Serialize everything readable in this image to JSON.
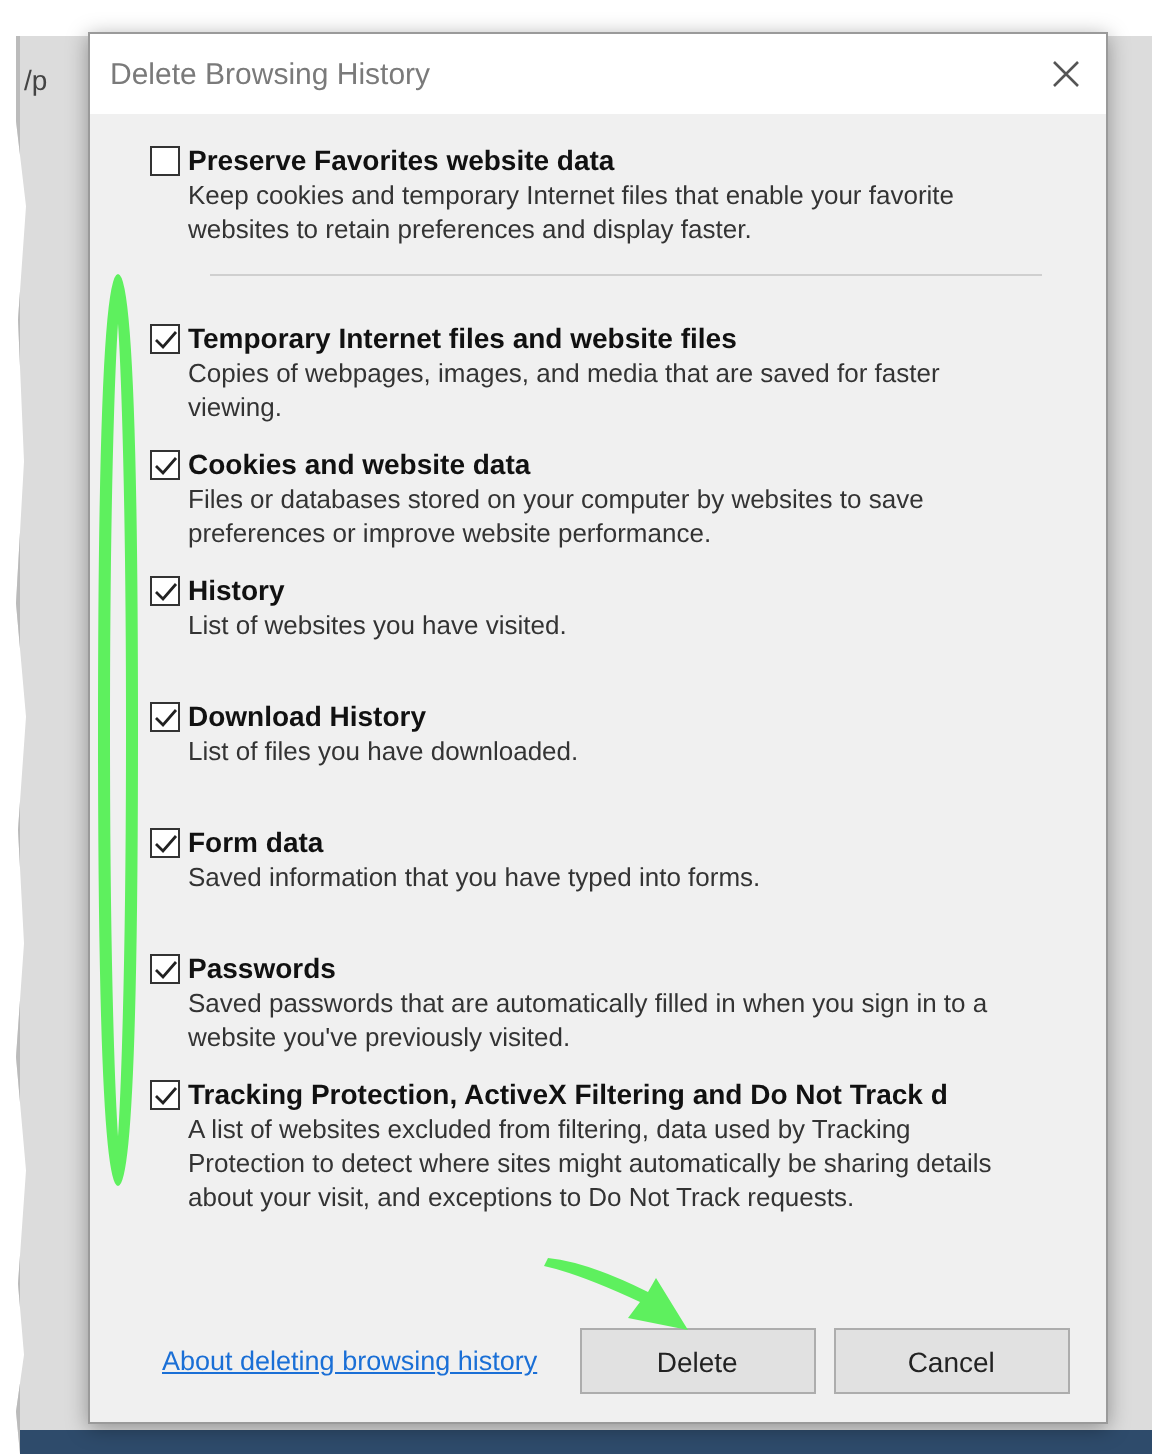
{
  "background": {
    "address_fragment": "/p"
  },
  "dialog": {
    "title": "Delete Browsing History",
    "preserve_option": {
      "label": "Preserve Favorites website data",
      "description": "Keep cookies and temporary Internet files that enable your favorite websites to retain preferences and display faster.",
      "checked": false
    },
    "options": [
      {
        "label": "Temporary Internet files and website files",
        "description": "Copies of webpages, images, and media that are saved for faster viewing.",
        "checked": true
      },
      {
        "label": "Cookies and website data",
        "description": "Files or databases stored on your computer by websites to save preferences or improve website performance.",
        "checked": true
      },
      {
        "label": "History",
        "description": "List of websites you have visited.",
        "checked": true
      },
      {
        "label": "Download History",
        "description": "List of files you have downloaded.",
        "checked": true
      },
      {
        "label": "Form data",
        "description": "Saved information that you have typed into forms.",
        "checked": true
      },
      {
        "label": "Passwords",
        "description": "Saved passwords that are automatically filled in when you sign in to a website you've previously visited.",
        "checked": true
      },
      {
        "label": "Tracking Protection, ActiveX Filtering and Do Not Track d",
        "description": "A list of websites excluded from filtering, data used by Tracking Protection to detect where sites might automatically be sharing details about your visit, and exceptions to Do Not Track requests.",
        "checked": true
      }
    ],
    "link": "About deleting browsing history",
    "buttons": [
      "Delete",
      "Cancel"
    ]
  }
}
